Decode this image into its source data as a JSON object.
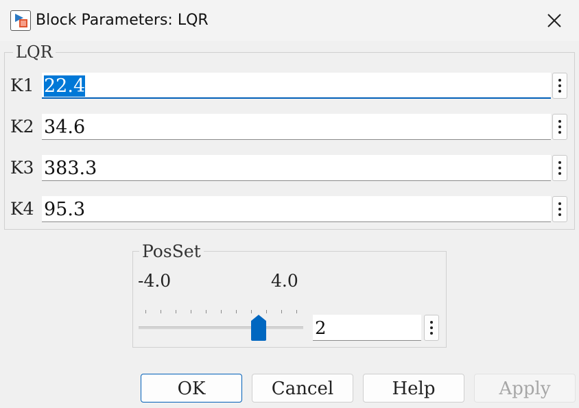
{
  "window": {
    "title": "Block Parameters: LQR"
  },
  "lqr_group": {
    "legend": "LQR",
    "params": [
      {
        "label": "K1",
        "value": "22.4",
        "selected": true
      },
      {
        "label": "K2",
        "value": "34.6"
      },
      {
        "label": "K3",
        "value": "383.3"
      },
      {
        "label": "K4",
        "value": "95.3"
      }
    ]
  },
  "posset_group": {
    "legend": "PosSet",
    "slider_min_label": "-4.0",
    "slider_max_label": "4.0",
    "slider_value": "2",
    "slider_min": -4.0,
    "slider_max": 4.0,
    "slider_current": 2
  },
  "buttons": {
    "ok": "OK",
    "cancel": "Cancel",
    "help": "Help",
    "apply": "Apply"
  },
  "icons": {
    "close": "close-icon",
    "more": "more-options-icon",
    "app": "simulink-block-icon"
  },
  "colors": {
    "accent": "#005fb8",
    "selection": "#0078d7",
    "slider_thumb": "#0067c0"
  }
}
